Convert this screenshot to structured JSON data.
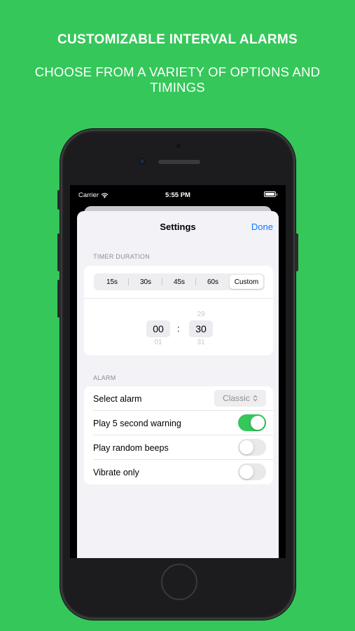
{
  "promo": {
    "title": "CUSTOMIZABLE INTERVAL ALARMS",
    "subtitle": "CHOOSE FROM A VARIETY OF OPTIONS AND TIMINGS"
  },
  "status_bar": {
    "carrier": "Carrier",
    "time": "5:55 PM"
  },
  "nav": {
    "title": "Settings",
    "done_label": "Done"
  },
  "timer": {
    "header": "TIMER DURATION",
    "segments": [
      "15s",
      "30s",
      "45s",
      "60s",
      "Custom"
    ],
    "selected_segment": "Custom",
    "picker": {
      "minutes": "00",
      "minutes_below": "01",
      "separator": ":",
      "seconds_above": "29",
      "seconds": "30",
      "seconds_below": "31"
    }
  },
  "alarm": {
    "header": "ALARM",
    "select_label": "Select alarm",
    "select_value": "Classic",
    "rows": [
      {
        "label": "Play 5 second warning",
        "on": true
      },
      {
        "label": "Play random beeps",
        "on": false
      },
      {
        "label": "Vibrate only",
        "on": false
      }
    ]
  },
  "colors": {
    "background": "#35c75a",
    "accent": "#0a7aff",
    "toggle_on": "#34c759"
  }
}
